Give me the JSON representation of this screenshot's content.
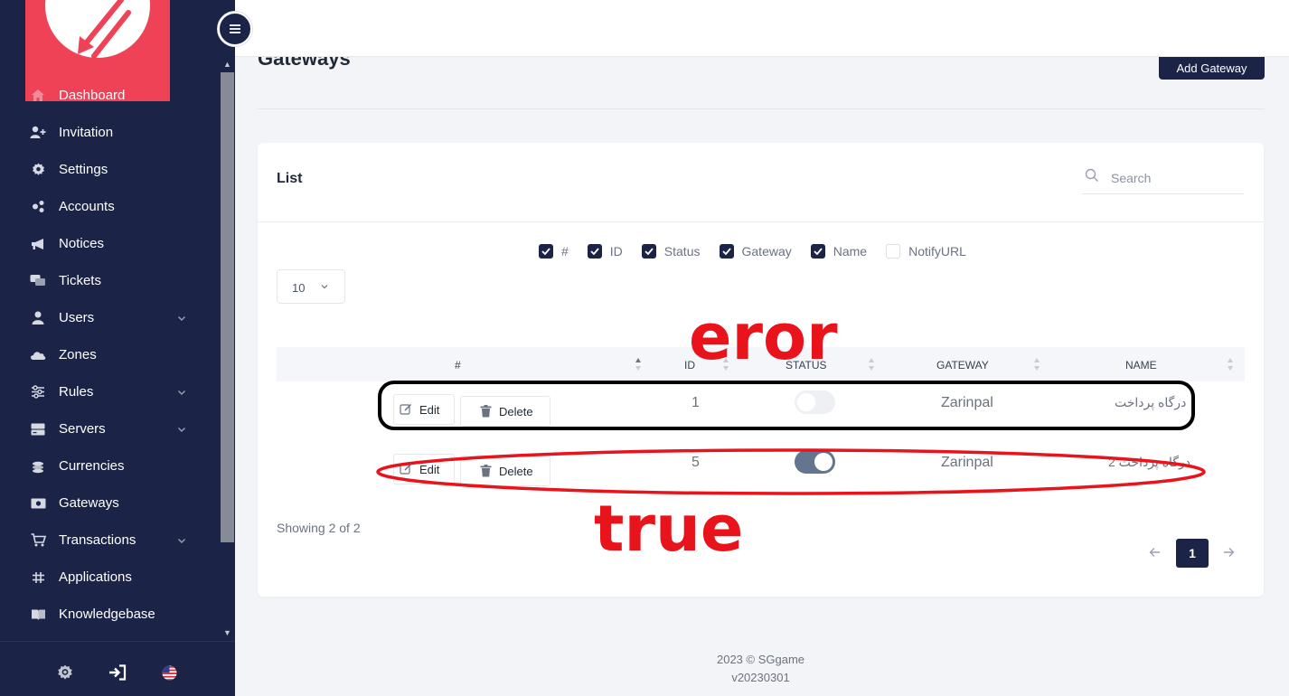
{
  "sidebar": {
    "items": [
      {
        "label": "Dashboard",
        "icon": "home-icon",
        "chevron": false
      },
      {
        "label": "Invitation",
        "icon": "user-plus-icon",
        "chevron": false
      },
      {
        "label": "Settings",
        "icon": "gear-icon",
        "chevron": false
      },
      {
        "label": "Accounts",
        "icon": "accounts-icon",
        "chevron": false
      },
      {
        "label": "Notices",
        "icon": "megaphone-icon",
        "chevron": false
      },
      {
        "label": "Tickets",
        "icon": "chat-icon",
        "chevron": false
      },
      {
        "label": "Users",
        "icon": "user-icon",
        "chevron": true
      },
      {
        "label": "Zones",
        "icon": "cloud-icon",
        "chevron": false
      },
      {
        "label": "Rules",
        "icon": "sliders-icon",
        "chevron": true
      },
      {
        "label": "Servers",
        "icon": "server-icon",
        "chevron": true
      },
      {
        "label": "Currencies",
        "icon": "coins-icon",
        "chevron": false
      },
      {
        "label": "Gateways",
        "icon": "money-icon",
        "chevron": false
      },
      {
        "label": "Transactions",
        "icon": "cart-icon",
        "chevron": true
      },
      {
        "label": "Applications",
        "icon": "signpost-icon",
        "chevron": false
      },
      {
        "label": "Knowledgebase",
        "icon": "book-icon",
        "chevron": false
      }
    ],
    "bottom_icons": [
      "gear-icon",
      "sign-in-icon",
      "us-flag-icon"
    ]
  },
  "page": {
    "title": "Gateways",
    "add_button": "Add Gateway"
  },
  "list": {
    "title": "List",
    "search_placeholder": "Search",
    "column_toggles": [
      {
        "label": "#",
        "checked": true
      },
      {
        "label": "ID",
        "checked": true
      },
      {
        "label": "Status",
        "checked": true
      },
      {
        "label": "Gateway",
        "checked": true
      },
      {
        "label": "Name",
        "checked": true
      },
      {
        "label": "NotifyURL",
        "checked": false
      }
    ],
    "page_size": "10",
    "headers": {
      "num": "#",
      "id": "ID",
      "status": "STATUS",
      "gateway": "GATEWAY",
      "name": "NAME"
    },
    "rows": [
      {
        "id": "1",
        "status_on": false,
        "gateway": "Zarinpal",
        "name": "درگاه پرداخت"
      },
      {
        "id": "5",
        "status_on": true,
        "gateway": "Zarinpal",
        "name": "درگاه پرداخت 2"
      }
    ],
    "edit_label": "Edit",
    "delete_label": "Delete",
    "showing": "Showing 2 of 2",
    "current_page": "1"
  },
  "footer": {
    "copyright": "2023 © SGgame",
    "version": "v20230301"
  },
  "annotations": {
    "error_label": "eror",
    "true_label": "true",
    "error_color": "#000000",
    "true_color": "#e8131b"
  },
  "colors": {
    "sidebar_bg": "#1b2447",
    "accent": "#1b2447",
    "logo_bg": "#ef4257"
  }
}
